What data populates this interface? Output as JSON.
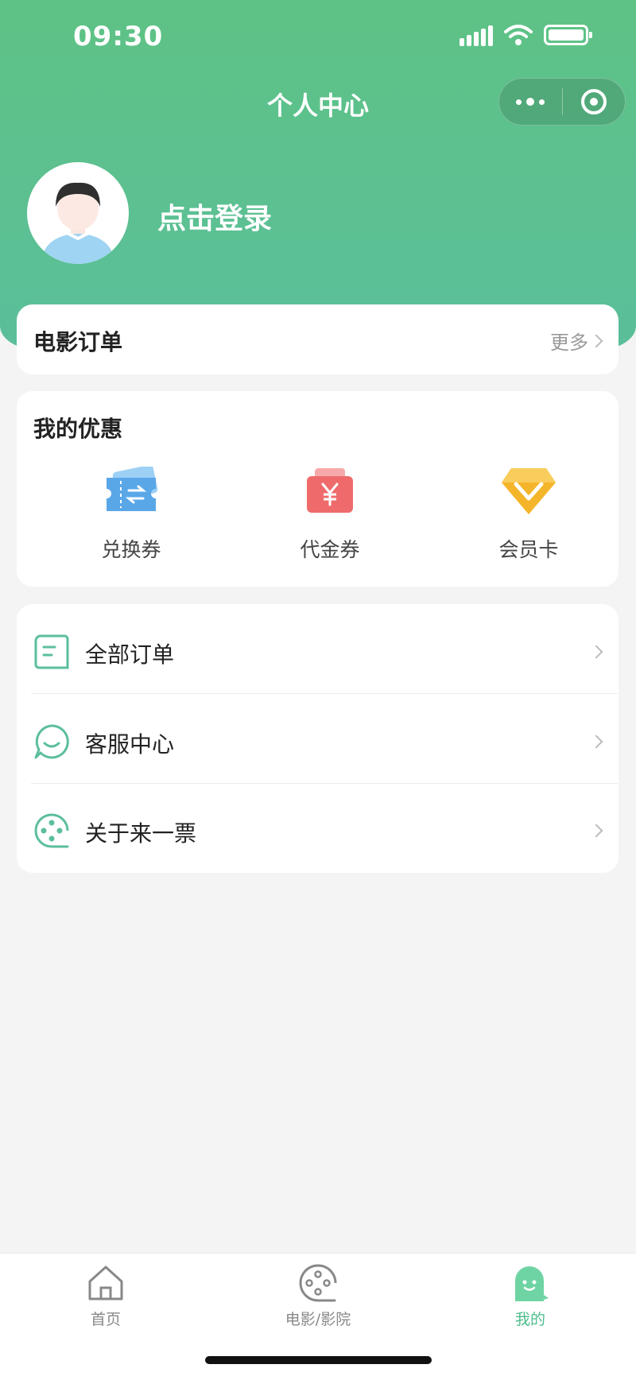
{
  "status_bar": {
    "time": "09:30"
  },
  "header": {
    "title": "个人中心",
    "login_text": "点击登录"
  },
  "capsule": {
    "more_icon": "more-dots-icon",
    "close_icon": "target-icon"
  },
  "movie_orders": {
    "title": "电影订单",
    "more_label": "更多"
  },
  "promotions": {
    "title": "我的优惠",
    "items": [
      {
        "label": "兑换券",
        "icon": "exchange-ticket-icon",
        "color": "#5aa7e8"
      },
      {
        "label": "代金券",
        "icon": "voucher-yen-icon",
        "color": "#ef6b6b"
      },
      {
        "label": "会员卡",
        "icon": "vip-card-icon",
        "color": "#f5b52b"
      }
    ]
  },
  "menu": {
    "items": [
      {
        "label": "全部订单",
        "icon": "orders-icon"
      },
      {
        "label": "客服中心",
        "icon": "customer-service-icon"
      },
      {
        "label": "关于来一票",
        "icon": "about-film-icon"
      }
    ]
  },
  "tabbar": {
    "items": [
      {
        "label": "首页",
        "icon": "home-icon",
        "active": false
      },
      {
        "label": "电影/影院",
        "icon": "film-reel-icon",
        "active": false
      },
      {
        "label": "我的",
        "icon": "ghost-icon",
        "active": true
      }
    ]
  },
  "colors": {
    "primary": "#5ec285",
    "accent_text": "#4cbd8b",
    "background": "#f4f4f4"
  }
}
